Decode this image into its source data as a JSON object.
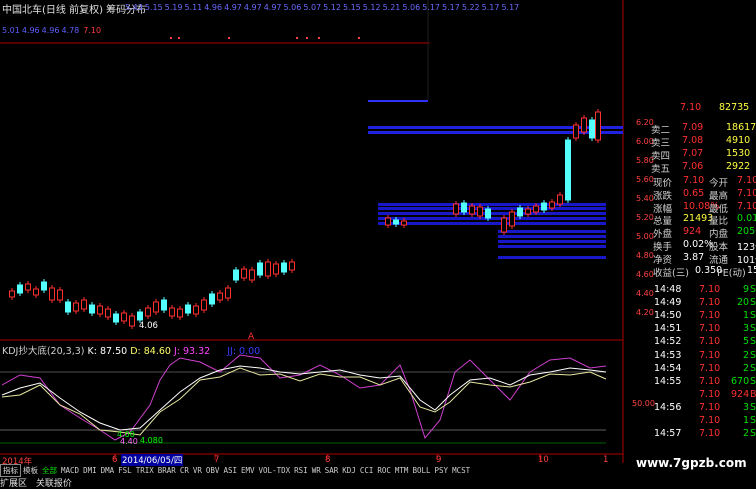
{
  "header": {
    "title": "中国北车(日线 前复权) 筹码分布",
    "price_row1": [
      "5.43",
      "5.15",
      "5.19",
      "5.11",
      "4.96",
      "4.97",
      "4.97",
      "4.97",
      "5.06",
      "5.07",
      "5.12",
      "5.15",
      "5.12",
      "5.21",
      "5.06",
      "5.17",
      "5.17",
      "5.22",
      "5.17",
      "5.17"
    ],
    "price_row2": [
      "5.01",
      "4.96",
      "4.96",
      "4.78"
    ],
    "price_row2_hi": "7.10"
  },
  "kdj": {
    "label": "KDJ抄大底(20,3,3)",
    "k": "K: 87.50",
    "d": "D: 84.60",
    "j": "J: 93.32",
    "jj": "JJ: 0.00"
  },
  "axis": {
    "y_right": [
      "6.20",
      "6.00",
      "5.80",
      "5.60",
      "5.40",
      "5.20",
      "5.00",
      "4.80",
      "4.60",
      "4.40",
      "4.20"
    ],
    "kdj_level": "50.00",
    "low_label": "4.06",
    "cluster_labels": [
      "4.00",
      "4.40",
      "4.080"
    ],
    "x_labels": [
      "2014年",
      "6",
      "7",
      "8",
      "9",
      "10",
      "1"
    ],
    "x_date": "2014/06/05/四",
    "marker": "A"
  },
  "panel": {
    "sell_rows": [
      {
        "label": "卖二",
        "price": "7.09",
        "vol": "18617"
      },
      {
        "label": "卖三",
        "price": "7.08",
        "vol": "4910"
      },
      {
        "label": "卖四",
        "price": "7.07",
        "vol": "1530"
      },
      {
        "label": "卖五",
        "price": "7.06",
        "vol": "2922"
      }
    ],
    "top_partial": {
      "price": "7.10",
      "vol": "82735"
    },
    "stats": [
      {
        "l1": "现价",
        "v1": "7.10",
        "l2": "今开",
        "v2": "7.10"
      },
      {
        "l1": "涨跌",
        "v1": "0.65",
        "l2": "最高",
        "v2": "7.10"
      },
      {
        "l1": "涨幅",
        "v1": "10.08%",
        "l2": "最低",
        "v2": "7.10"
      },
      {
        "l1": "总量",
        "v1": "21493",
        "l2": "量比",
        "v2": "0.01"
      },
      {
        "l1": "外盘",
        "v1": "924",
        "l2": "内盘",
        "v2": "20569"
      },
      {
        "l1": "换手",
        "v1": "0.02%",
        "l2": "股本",
        "v2": "123亿"
      },
      {
        "l1": "净资",
        "v1": "3.87",
        "l2": "流通",
        "v2": "101亿"
      },
      {
        "l1": "收益(三)",
        "v1": "0.350",
        "l2": "PE(动)",
        "v2": "15.2"
      }
    ],
    "ticks": [
      {
        "time": "14:48",
        "price": "7.10",
        "vol": "9",
        "side": "S"
      },
      {
        "time": "14:49",
        "price": "7.10",
        "vol": "20",
        "side": "S"
      },
      {
        "time": "14:50",
        "price": "7.10",
        "vol": "1",
        "side": "S"
      },
      {
        "time": "14:51",
        "price": "7.10",
        "vol": "3",
        "side": "S"
      },
      {
        "time": "14:52",
        "price": "7.10",
        "vol": "5",
        "side": "S"
      },
      {
        "time": "14:53",
        "price": "7.10",
        "vol": "2",
        "side": "S"
      },
      {
        "time": "14:54",
        "price": "7.10",
        "vol": "2",
        "side": "S"
      },
      {
        "time": "14:55",
        "price": "7.10",
        "vol": "670",
        "side": "S"
      },
      {
        "time": "",
        "price": "7.10",
        "vol": "924",
        "side": "B"
      },
      {
        "time": "14:56",
        "price": "7.10",
        "vol": "3",
        "side": "S"
      },
      {
        "time": "",
        "price": "7.10",
        "vol": "1",
        "side": "S"
      },
      {
        "time": "14:57",
        "price": "7.10",
        "vol": "2",
        "side": "S"
      }
    ]
  },
  "tabs": [
    "指标",
    "模板",
    "全部",
    "MACD",
    "DMI",
    "DMA",
    "FSL",
    "TRIX",
    "BRAR",
    "CR",
    "VR",
    "OBV",
    "ASI",
    "EMV",
    "VOL-TDX",
    "RSI",
    "WR",
    "SAR",
    "KDJ",
    "CCI",
    "ROC",
    "MTM",
    "BOLL",
    "PSY",
    "MCST"
  ],
  "bottom": [
    "扩展区",
    "关联报价"
  ],
  "watermark": "www.7gpzb.com"
}
